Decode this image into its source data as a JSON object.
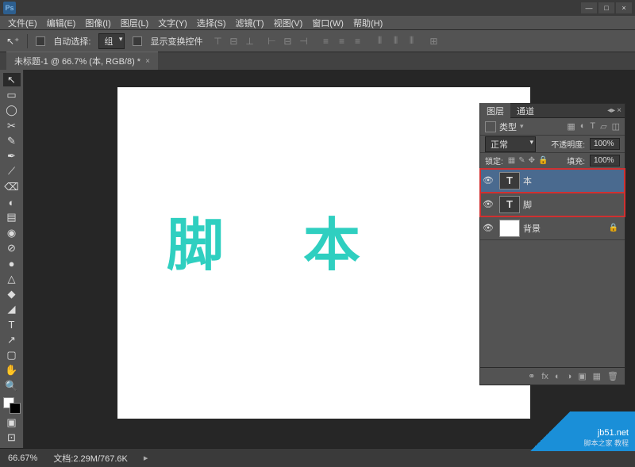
{
  "app": {
    "logo_text": "Ps"
  },
  "window_controls": {
    "min": "—",
    "max": "□",
    "close": "×"
  },
  "menu": [
    "文件(E)",
    "编辑(E)",
    "图像(I)",
    "图层(L)",
    "文字(Y)",
    "选择(S)",
    "滤镜(T)",
    "视图(V)",
    "窗口(W)",
    "帮助(H)"
  ],
  "options": {
    "auto_select": "自动选择:",
    "group": "组",
    "show_transform": "显示变换控件"
  },
  "doc_tab": {
    "title": "未标题-1 @ 66.7% (本, RGB/8) *",
    "close": "×"
  },
  "canvas": {
    "text": "脚 本"
  },
  "tools": [
    "↖",
    "▭",
    "◯",
    "✂",
    "✎",
    "✒",
    "⟋",
    "⌫",
    "◐",
    "▤",
    "◉",
    "⊘",
    "●",
    "△",
    "◆",
    "◢",
    "T",
    "↗",
    "▢",
    "✋",
    "🔍"
  ],
  "layers_panel": {
    "tabs": {
      "layers": "图层",
      "channels": "通道"
    },
    "filter_label": "类型",
    "blend_mode": "正常",
    "opacity_label": "不透明度:",
    "opacity_value": "100%",
    "lock_label": "锁定:",
    "fill_label": "填充:",
    "fill_value": "100%",
    "layers": [
      {
        "name": "本",
        "type": "T",
        "visible": true,
        "selected": true,
        "highlighted": true
      },
      {
        "name": "脚",
        "type": "T",
        "visible": true,
        "selected": false,
        "highlighted": true
      },
      {
        "name": "背景",
        "type": "img",
        "visible": true,
        "selected": false,
        "locked": true
      }
    ]
  },
  "status": {
    "zoom": "66.67%",
    "doc_info": "文档:2.29M/767.6K"
  },
  "watermark": {
    "line1": "jb51.net",
    "line2": "脚本之家 教程"
  }
}
